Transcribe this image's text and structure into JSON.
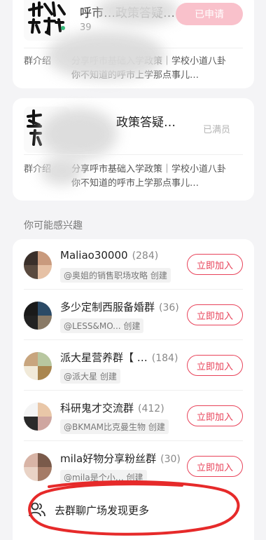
{
  "groups": [
    {
      "name": "呼市…政策答疑…",
      "sub": "39",
      "action": "已申请",
      "intro_label": "群介绍",
      "intro_lines": [
        "分享呼市基础入学政策｜学校小道八卦",
        "你不知道的呼市上学那点事儿…"
      ]
    },
    {
      "name": "政策答疑…",
      "action": "已满员",
      "intro_label": "群介绍",
      "intro_lines": [
        "分享呼市基础入学政策｜学校小道八卦",
        "你不知道的呼市上学那点事儿…"
      ]
    }
  ],
  "section_title": "你可能感兴趣",
  "recommendations": [
    {
      "name": "Maliao30000",
      "count": "(284)",
      "creator": "@奥姐的销售职场攻略 创建",
      "join": "立即加入",
      "avatar_colors": [
        "#3a2f2a",
        "#c99a7d",
        "#5a4a3f",
        "#e6c1a5"
      ]
    },
    {
      "name": "多少定制西服备婚群",
      "count": "(36)",
      "creator": "@LESS&MO... 创建",
      "join": "立即加入",
      "avatar_colors": [
        "#1a1a1a",
        "#2b4a66",
        "#222222",
        "#8a7a66"
      ]
    },
    {
      "name": "派大星营养群【 …",
      "count": "(184)",
      "creator": "@派大星 创建",
      "join": "立即加入",
      "avatar_colors": [
        "#c8a57e",
        "#b8c7a0",
        "#f1ead9",
        "#a9864f"
      ]
    },
    {
      "name": "科研鬼才交流群",
      "count": "(412)",
      "creator": "@BKMAM比克曼生物 创建",
      "join": "立即加入",
      "avatar_colors": [
        "#f4f4f4",
        "#e9c7a8",
        "#2a2a2a",
        "#cfa6a0"
      ]
    },
    {
      "name": "mila好物分享粉丝群",
      "count": "(30)",
      "creator": "@mila是个小… 创建",
      "join": "立即加入",
      "avatar_colors": [
        "#d8b4a6",
        "#7a5a4a",
        "#e9d3c6",
        "#a57b66"
      ]
    }
  ],
  "more_label": "去群聊广场发现更多",
  "accent_color": "#e8435a",
  "icons": [
    "group-logo-icon",
    "people-icon",
    "chevron-right-icon"
  ]
}
